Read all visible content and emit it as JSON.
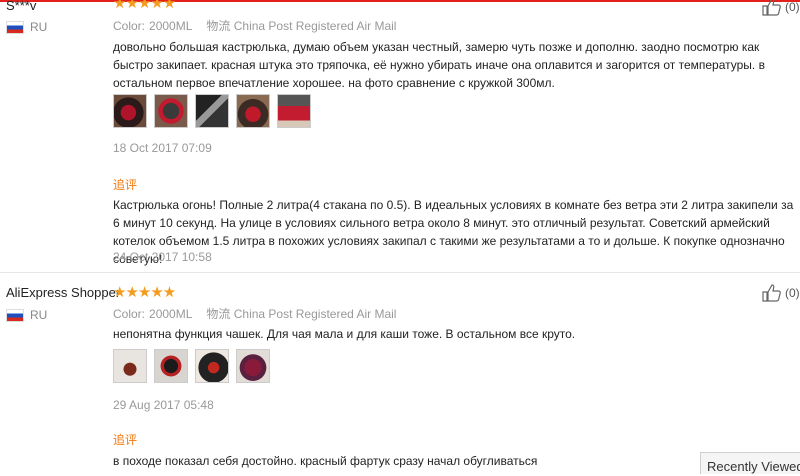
{
  "reviews": [
    {
      "username": "S***v",
      "country": "RU",
      "stars": "★★★★★",
      "color_label": "Color:",
      "color_value": "2000ML",
      "shipping": "物流 China Post Registered Air Mail",
      "text": "довольно большая кастрюлька, думаю объем указан честный, замерю чуть позже и дополню. заодно посмотрю как быстро закипает. красная штука это тряпочка, её нужно убирать иначе она оплавится и загорится от температуры. в остальном первое впечатление хорошее. на фото сравнение с кружкой 300мл.",
      "date": "18 Oct 2017 07:09",
      "additional_label": "追评",
      "additional_text": "Кастрюлька огонь! Полные 2 литра(4 стакана по 0.5). В идеальных условиях в комнате без ветра эти 2 литра закипели за 6 минут 10 секунд. На улице в условиях сильного ветра около 8 минут. это отличный результат. Советский армейский котелок объемом 1.5 литра в похожих условиях закипал с такими же результатами а то и дольше. К покупке однозначно советую!",
      "additional_date": "24 Oct 2017 10:58",
      "helpful_count": "(0)"
    },
    {
      "username": "AliExpress Shopper",
      "country": "RU",
      "stars": "★★★★★",
      "color_label": "Color:",
      "color_value": "2000ML",
      "shipping": "物流 China Post Registered Air Mail",
      "text": "непонятна функция чашек. Для чая мала и для каши тоже. В остальном все круто.",
      "date": "29 Aug 2017 05:48",
      "additional_label": "追评",
      "additional_text": "в походе показал себя достойно. красный фартук сразу начал обугливаться",
      "helpful_count": "(0)"
    }
  ],
  "recently_viewed": "Recently Viewed",
  "colors": {
    "star": "#f49c1f",
    "accent_orange": "#f2780c",
    "top_border": "#e2201c"
  }
}
